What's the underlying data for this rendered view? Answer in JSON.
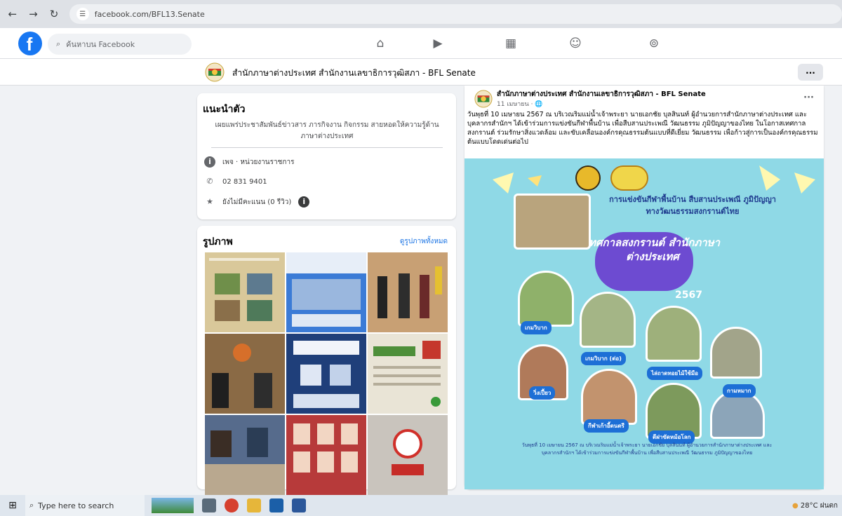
{
  "browser": {
    "back_icon": "arrow-left-icon",
    "url": "facebook.com/BFL13.Senate"
  },
  "header": {
    "logo": "f",
    "search_placeholder": "ค้นหาบน Facebook",
    "nav_icons": [
      "home-icon",
      "video-icon",
      "marketplace-icon",
      "groups-icon",
      "gaming-icon"
    ]
  },
  "page": {
    "title": "สำนักภาษาต่างประเทศ สำนักงานเลขาธิการวุฒิสภา - BFL Senate",
    "more_label": "..."
  },
  "intro": {
    "heading": "แนะนำตัว",
    "bio": "เผยแพร่ประชาสัมพันธ์ข่าวสาร ภารกิจงาน กิจกรรม สายหอดให้ความรู้ด้าน ภาษาต่างประเทศ",
    "category": "เพจ · หน่วยงานราชการ",
    "phone": "02 831 9401",
    "rating": "ยังไม่มีคะแนน (0 รีวิว)"
  },
  "photos": {
    "heading": "รูปภาพ",
    "see_all": "ดูรูปภาพทั้งหมด",
    "tile_colors": [
      "#d9c89a",
      "#3b7bd6",
      "#c8a074",
      "#8a6a45",
      "#1f3f7a",
      "#e9e4d6",
      "#566b8c",
      "#b73a3a",
      "#c9c4bd"
    ]
  },
  "post": {
    "author": "สำนักภาษาต่างประเทศ สำนักงานเลขาธิการวุฒิสภา - BFL Senate",
    "date": "11 เมษายน · 🌐",
    "more": "···",
    "text": "วันพุธที่ 10 เมษายน 2567 ณ บริเวณริมแม่น้ำเจ้าพระยา นายเอกชัย บุลสินนท์ ผู้อำนวยการสำนักภาษาต่างประเทศ และบุคลากรสำนักฯ ได้เข้าร่วมการแข่งขันกีฬาพื้นบ้าน เพื่อสืบสานประเพณี วัฒนธรรม ภูมิปัญญาของไทย ในโอกาสเทศกาลสงกรานต์ ร่วมรักษาสิ่งแวดล้อม และขับเคลื่อนองค์กรคุณธรรมต้นแบบที่ดีเยี่ยม วัฒนธรรม เพื่อก้าวสู่การเป็นองค์กรคุณธรรมต้นแบบโดดเด่นต่อไป",
    "poster": {
      "headline": "การแข่งขันกีฬาพื้นบ้าน สืบสานประเพณี ภูมิปัญญาทางวัฒนธรรมสงกรานต์ไทย",
      "event": "เทศกาลสงกรานต์ สำนักภาษาต่างประเทศ",
      "year": "2567",
      "tags": [
        "เกมวิบาก",
        "เกมวิบาก (ต่อ)",
        "ไล่ถาดทอยไม้ใช้มือ",
        "วิ่งเปี้ยว",
        "กีฬาเก้าอี้ดนตรี",
        "ตีฝาขัดหม้อโลก",
        "กามหมาก"
      ],
      "footer": "วันพุธที่ 10 เมษายน 2567 ณ บริเวณริมแม่น้ำเจ้าพระยา นายเอกชัย บุลสินนท์ ผู้อำนวยการสำนักภาษาต่างประเทศ และบุคลากรสำนักฯ ได้เข้าร่วมการแข่งขันกีฬาพื้นบ้าน เพื่อสืบสานประเพณี วัฒนธรรม ภูมิปัญญาของไทย"
    }
  },
  "taskbar": {
    "search_placeholder": "Type here to search",
    "weather": "28°C ฝนตก"
  }
}
